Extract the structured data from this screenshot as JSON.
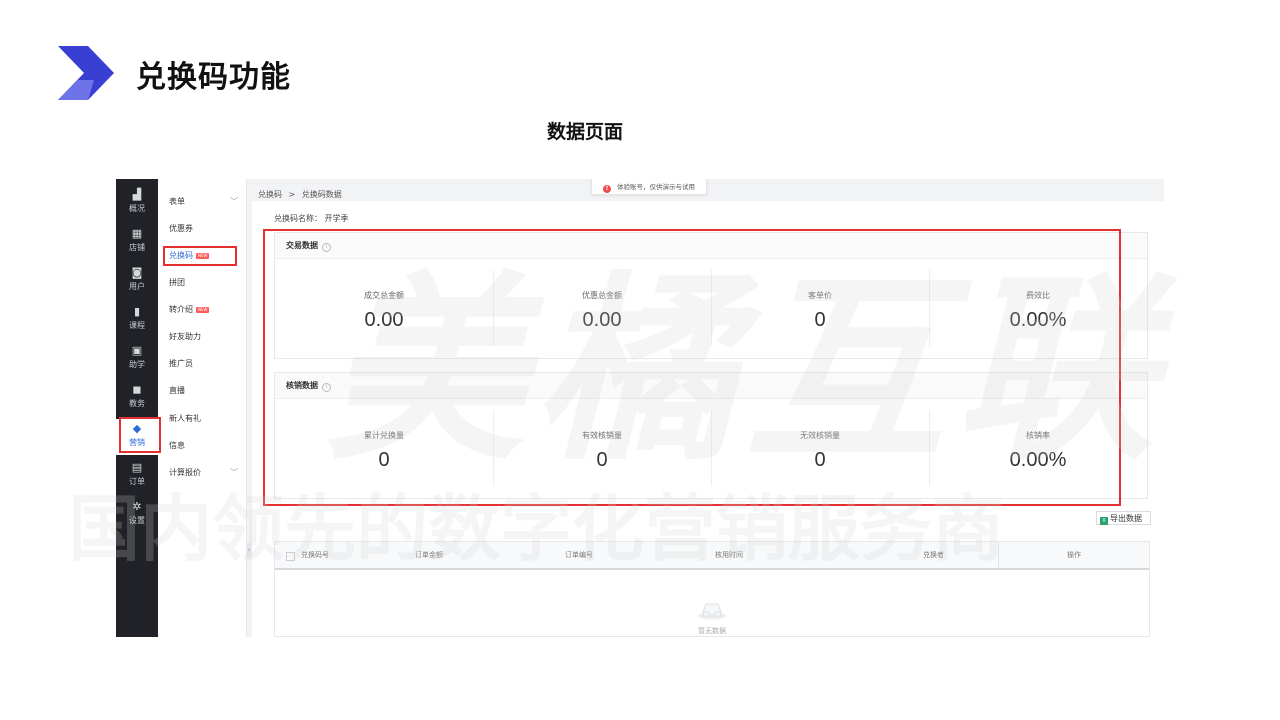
{
  "slide": {
    "title": "兑换码功能",
    "subtitle": "数据页面"
  },
  "colors": {
    "accent": "#2f6bd8",
    "highlight": "#e33131",
    "sidebar_bg": "#212227",
    "brand_logo": "#3a3fd4"
  },
  "iconbar": {
    "items": [
      {
        "label": "概况",
        "icon": "chart-icon"
      },
      {
        "label": "店铺",
        "icon": "store-icon"
      },
      {
        "label": "用户",
        "icon": "users-icon"
      },
      {
        "label": "课程",
        "icon": "book-icon"
      },
      {
        "label": "助学",
        "icon": "tv-icon"
      },
      {
        "label": "教务",
        "icon": "board-icon"
      },
      {
        "label": "营销",
        "icon": "tag-icon"
      },
      {
        "label": "订单",
        "icon": "document-icon"
      },
      {
        "label": "设置",
        "icon": "gear-icon"
      }
    ],
    "active_index": 6
  },
  "submenu": {
    "items": [
      "表单",
      "优惠券",
      "兑换码",
      "拼团",
      "转介绍",
      "好友助力",
      "推广员",
      "直播",
      "新人有礼",
      "信息",
      "计算报价"
    ],
    "new_badge": "NEW",
    "active": "兑换码"
  },
  "breadcrumb": {
    "root": "兑换码",
    "sep": ">",
    "current": "兑换码数据"
  },
  "toast": {
    "icon": "!",
    "text": "体验账号，仅供演示与试用"
  },
  "code_name": {
    "label": "兑换码名称：",
    "value": "开学季"
  },
  "trade": {
    "title": "交易数据",
    "stats": [
      {
        "label": "成交总金额",
        "value": "0.00"
      },
      {
        "label": "优惠总金额",
        "value": "0.00"
      },
      {
        "label": "客单价",
        "value": "0"
      },
      {
        "label": "费效比",
        "value": "0.00%"
      }
    ]
  },
  "writeoff": {
    "title": "核销数据",
    "stats": [
      {
        "label": "累计兑换量",
        "value": "0"
      },
      {
        "label": "有效核销量",
        "value": "0"
      },
      {
        "label": "无效核销量",
        "value": "0"
      },
      {
        "label": "核销率",
        "value": "0.00%"
      }
    ]
  },
  "export": {
    "label": "导出数据",
    "icon": "X"
  },
  "table": {
    "columns": [
      "兑换码号",
      "订单金额",
      "订单编号",
      "核用时间",
      "兑换者",
      "操作"
    ],
    "empty_text": "暂无数据"
  },
  "watermark": {
    "line1": "美橘互联",
    "line2": "国内领先的数字化营销服务商"
  }
}
